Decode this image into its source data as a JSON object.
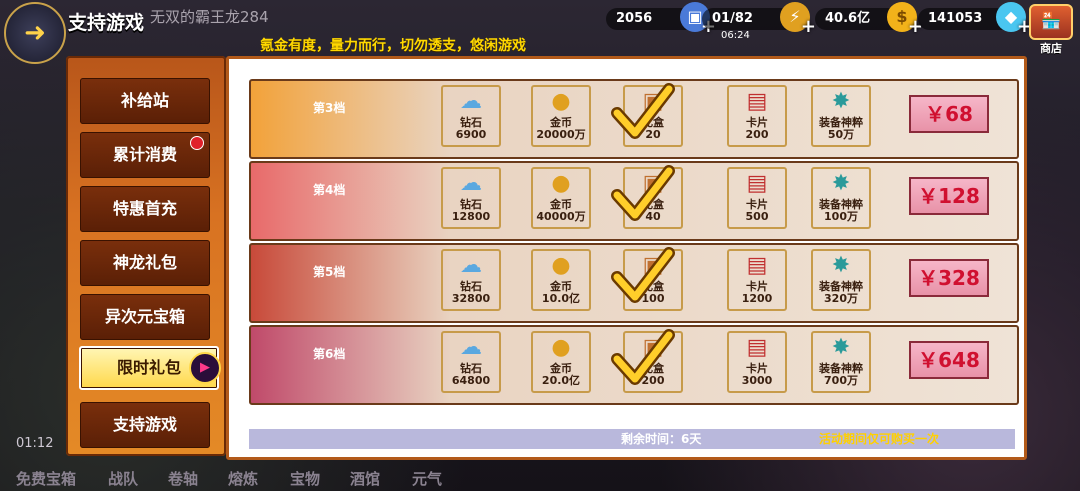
{
  "header": {
    "title": "支持游戏",
    "player_name": "无双的霸王龙284",
    "slogan": "氪金有度，量力而行，切勿透支，悠闲游戏",
    "resources": [
      {
        "value": "2056",
        "icon": "ticket-icon"
      },
      {
        "value": "01/82",
        "icon": "sword-icon"
      },
      {
        "value": "40.6亿",
        "icon": "gold-coin-icon"
      },
      {
        "value": "141053",
        "icon": "diamond-icon"
      }
    ],
    "timer": "06:24",
    "shop_label": "商店"
  },
  "menu": {
    "items": [
      {
        "label": "补给站"
      },
      {
        "label": "累计消费",
        "badge": true
      },
      {
        "label": "特惠首充"
      },
      {
        "label": "神龙礼包"
      },
      {
        "label": "异次元宝箱"
      },
      {
        "label": "限时礼包",
        "active": true
      },
      {
        "label": "支持游戏"
      }
    ]
  },
  "tiers": [
    {
      "name": "第3档",
      "color": "#f2a23a",
      "items": [
        {
          "name": "钻石",
          "amount": "6900"
        },
        {
          "name": "金币",
          "amount": "20000万"
        },
        {
          "name": "礼盒",
          "amount": "20"
        },
        {
          "name": "卡片",
          "amount": "200"
        },
        {
          "name": "装备神粹",
          "amount": "50万"
        }
      ],
      "price": "￥68"
    },
    {
      "name": "第4档",
      "color": "#e86a6a",
      "items": [
        {
          "name": "钻石",
          "amount": "12800"
        },
        {
          "name": "金币",
          "amount": "40000万"
        },
        {
          "name": "礼盒",
          "amount": "40"
        },
        {
          "name": "卡片",
          "amount": "500"
        },
        {
          "name": "装备神粹",
          "amount": "100万"
        }
      ],
      "price": "￥128"
    },
    {
      "name": "第5档",
      "color": "#c84a3a",
      "items": [
        {
          "name": "钻石",
          "amount": "32800"
        },
        {
          "name": "金币",
          "amount": "10.0亿"
        },
        {
          "name": "礼盒",
          "amount": "100"
        },
        {
          "name": "卡片",
          "amount": "1200"
        },
        {
          "name": "装备神粹",
          "amount": "320万"
        }
      ],
      "price": "￥328"
    },
    {
      "name": "第6档",
      "color": "#c04a6a",
      "items": [
        {
          "name": "钻石",
          "amount": "64800"
        },
        {
          "name": "金币",
          "amount": "20.0亿"
        },
        {
          "name": "礼盒",
          "amount": "200"
        },
        {
          "name": "卡片",
          "amount": "3000"
        },
        {
          "name": "装备神粹",
          "amount": "700万"
        }
      ],
      "price": "￥648"
    }
  ],
  "footer": {
    "remaining": "剩余时间：6天",
    "note": "活动期间仅可购买一次"
  },
  "bottom_nav": [
    "免费宝箱",
    "战队",
    "卷轴",
    "熔炼",
    "宝物",
    "酒馆",
    "元气"
  ],
  "clock": "01:12"
}
